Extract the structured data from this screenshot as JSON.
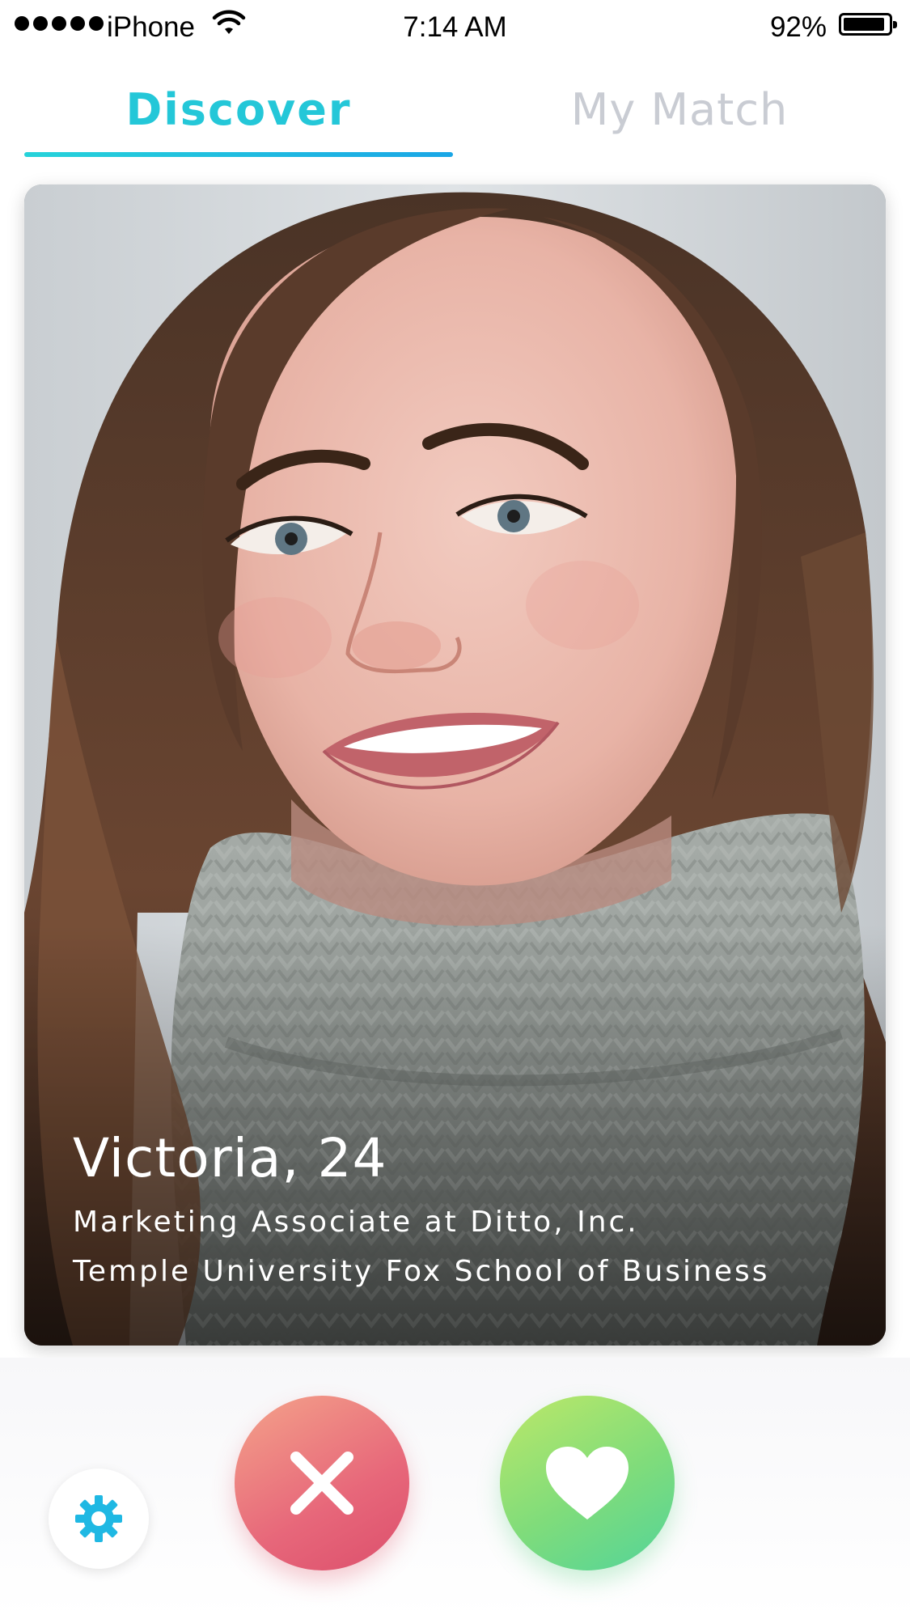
{
  "status_bar": {
    "carrier": "iPhone",
    "time": "7:14 AM",
    "battery_percent": "92%",
    "battery_level": 0.92
  },
  "tabs": [
    {
      "label": "Discover",
      "selected": true
    },
    {
      "label": "My Match",
      "selected": false
    }
  ],
  "profile": {
    "name_age": "Victoria, 24",
    "job": "Marketing Associate at Ditto, Inc.",
    "school": "Temple University Fox School of Business"
  },
  "actions": {
    "settings_icon": "gear-icon",
    "dislike_icon": "close-icon",
    "like_icon": "heart-icon"
  },
  "colors": {
    "accent": "#24c7d8",
    "inactive_tab": "#c9ccd3",
    "dislike_start": "#f4a38a",
    "dislike_end": "#dc4f6c",
    "like_start": "#bde868",
    "like_end": "#52d49a",
    "settings_icon": "#1fb8e3"
  }
}
